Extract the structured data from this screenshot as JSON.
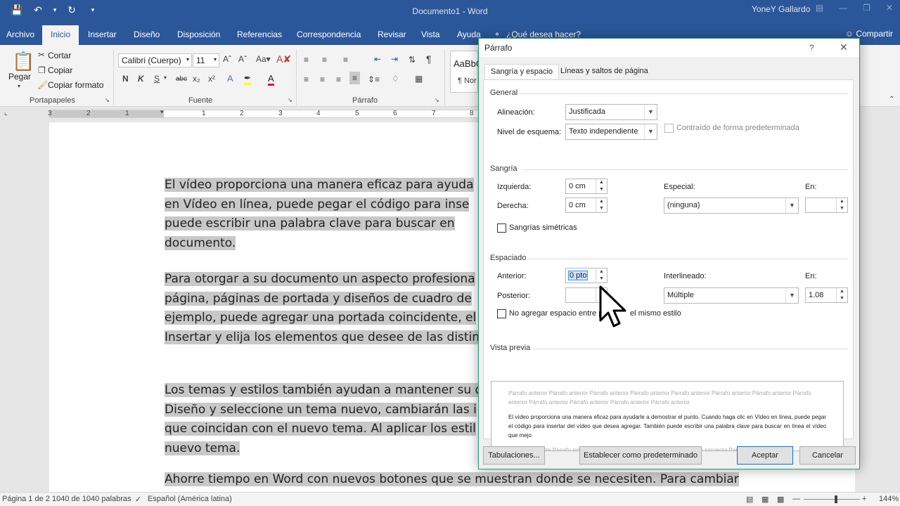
{
  "titlebar": {
    "qat_icons": [
      "save-icon",
      "undo-icon",
      "redo-icon",
      "customize-qat-icon"
    ],
    "document_title": "Documento1 - Word",
    "user_name": "YoneY Gallardo"
  },
  "ribbon_tabs": [
    "Archivo",
    "Inicio",
    "Insertar",
    "Diseño",
    "Disposición",
    "Referencias",
    "Correspondencia",
    "Revisar",
    "Vista",
    "Ayuda"
  ],
  "active_tab": "Inicio",
  "tell_me": "¿Qué desea hacer?",
  "share_label": "Compartir",
  "ribbon": {
    "clipboard": {
      "paste_label": "Pegar",
      "cut_label": "Cortar",
      "copy_label": "Copiar",
      "format_painter_label": "Copiar formato",
      "group_label": "Portapapeles"
    },
    "font": {
      "font_name": "Calibri (Cuerpo)",
      "font_size": "11",
      "bold": "N",
      "italic": "K",
      "underline": "S",
      "strikethrough": "abc",
      "subscript": "x₂",
      "superscript": "x²",
      "group_label": "Fuente"
    },
    "paragraph": {
      "group_label": "Párrafo"
    },
    "styles": {
      "sample": "AaBbC",
      "style_name": "¶ Nor"
    }
  },
  "ruler_numbers": [
    "3",
    "2",
    "1",
    "1",
    "2",
    "3",
    "4",
    "5",
    "6",
    "7",
    "8"
  ],
  "document": {
    "paragraphs": [
      [
        "El vídeo proporciona una manera eficaz para ayuda",
        "en Vídeo en línea, puede pegar el código para inse",
        "puede escribir una palabra clave para buscar en",
        "documento."
      ],
      [
        "Para otorgar a su documento un aspecto profesiona",
        "página, páginas de portada y diseños de cuadro de",
        "ejemplo, puede agregar una portada coincidente, el",
        "Insertar y elija los elementos que desee de las distin"
      ],
      [
        "Los temas y estilos también ayudan a mantener su d",
        "Diseño y seleccione un tema nuevo, cambiarán las i",
        "que coincidan con el nuevo tema. Al aplicar los estil",
        "nuevo tema."
      ],
      [
        "Ahorre tiempo en Word con nuevos botones que se muestran donde se necesiten. Para cambiar"
      ]
    ]
  },
  "statusbar": {
    "page": "Página 1 de 2",
    "words": "1040 de 1040 palabras",
    "language": "Español (América latina)",
    "zoom": "144%"
  },
  "dialog": {
    "title": "Párrafo",
    "help": "?",
    "tabs": [
      "Sangría y espacio",
      "Líneas y saltos de página"
    ],
    "general": {
      "section": "General",
      "alignment_label": "Alineación:",
      "alignment_value": "Justificada",
      "outline_label": "Nivel de esquema:",
      "outline_value": "Texto independiente",
      "collapsed_label": "Contraído de forma predeterminada"
    },
    "indent": {
      "section": "Sangría",
      "left_label": "Izquierda:",
      "left_value": "0 cm",
      "right_label": "Derecha:",
      "right_value": "0 cm",
      "special_label": "Especial:",
      "special_value": "(ninguna)",
      "by_label": "En:",
      "mirror_label": "Sangrías simétricas"
    },
    "spacing": {
      "section": "Espaciado",
      "before_label": "Anterior:",
      "before_value": "0 pto",
      "after_label": "Posterior:",
      "after_value": "",
      "line_label": "Interlineado:",
      "line_value": "Múltiple",
      "at_label": "En:",
      "at_value": "1.08",
      "no_space_label": "No agregar espacio entre p",
      "no_space_label_tail": "el mismo estilo"
    },
    "preview": {
      "section": "Vista previa",
      "prev_text": "Párrafo anterior Párrafo anterior Párrafo anterior Párrafo anterior Párrafo anterior Párrafo anterior Párrafo anterior Párrafo anterior Párrafo anterior Párrafo anterior Párrafo anterior Párrafo anterior",
      "main_text": "El vídeo proporciona una manera eficaz para ayudarle a demostrar el punto. Cuando haga clic en Vídeo en línea, puede pegar el código para insertar del vídeo que desea agregar. También puede escribir una palabra clave para buscar en línea el vídeo que mejo",
      "next_text": "Párrafo siguiente Párrafo siguiente Párrafo siguiente Párrafo siguiente Párrafo siguiente Párrafo siguiente"
    },
    "buttons": {
      "tabs": "Tabulaciones...",
      "set_default": "Establecer como predeterminado",
      "ok": "Aceptar",
      "cancel": "Cancelar"
    }
  }
}
